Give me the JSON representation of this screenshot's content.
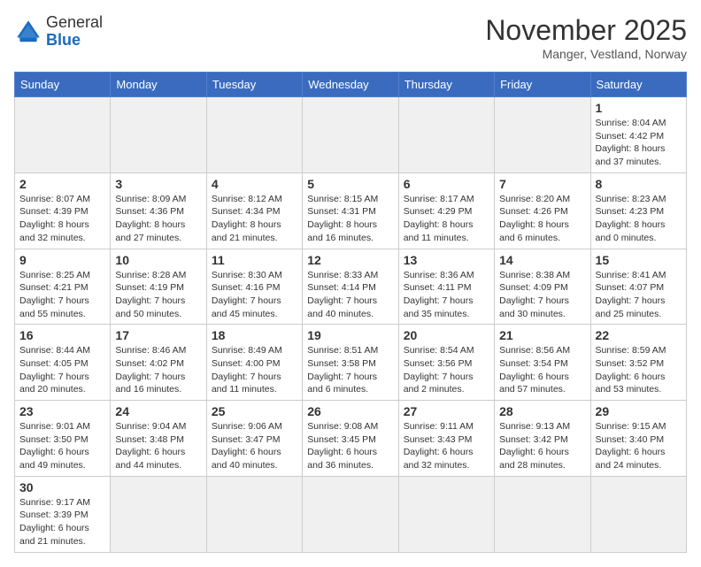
{
  "header": {
    "logo_general": "General",
    "logo_blue": "Blue",
    "month_title": "November 2025",
    "location": "Manger, Vestland, Norway"
  },
  "weekdays": [
    "Sunday",
    "Monday",
    "Tuesday",
    "Wednesday",
    "Thursday",
    "Friday",
    "Saturday"
  ],
  "weeks": [
    [
      {
        "day": null,
        "info": null
      },
      {
        "day": null,
        "info": null
      },
      {
        "day": null,
        "info": null
      },
      {
        "day": null,
        "info": null
      },
      {
        "day": null,
        "info": null
      },
      {
        "day": null,
        "info": null
      },
      {
        "day": "1",
        "info": "Sunrise: 8:04 AM\nSunset: 4:42 PM\nDaylight: 8 hours\nand 37 minutes."
      }
    ],
    [
      {
        "day": "2",
        "info": "Sunrise: 8:07 AM\nSunset: 4:39 PM\nDaylight: 8 hours\nand 32 minutes."
      },
      {
        "day": "3",
        "info": "Sunrise: 8:09 AM\nSunset: 4:36 PM\nDaylight: 8 hours\nand 27 minutes."
      },
      {
        "day": "4",
        "info": "Sunrise: 8:12 AM\nSunset: 4:34 PM\nDaylight: 8 hours\nand 21 minutes."
      },
      {
        "day": "5",
        "info": "Sunrise: 8:15 AM\nSunset: 4:31 PM\nDaylight: 8 hours\nand 16 minutes."
      },
      {
        "day": "6",
        "info": "Sunrise: 8:17 AM\nSunset: 4:29 PM\nDaylight: 8 hours\nand 11 minutes."
      },
      {
        "day": "7",
        "info": "Sunrise: 8:20 AM\nSunset: 4:26 PM\nDaylight: 8 hours\nand 6 minutes."
      },
      {
        "day": "8",
        "info": "Sunrise: 8:23 AM\nSunset: 4:23 PM\nDaylight: 8 hours\nand 0 minutes."
      }
    ],
    [
      {
        "day": "9",
        "info": "Sunrise: 8:25 AM\nSunset: 4:21 PM\nDaylight: 7 hours\nand 55 minutes."
      },
      {
        "day": "10",
        "info": "Sunrise: 8:28 AM\nSunset: 4:19 PM\nDaylight: 7 hours\nand 50 minutes."
      },
      {
        "day": "11",
        "info": "Sunrise: 8:30 AM\nSunset: 4:16 PM\nDaylight: 7 hours\nand 45 minutes."
      },
      {
        "day": "12",
        "info": "Sunrise: 8:33 AM\nSunset: 4:14 PM\nDaylight: 7 hours\nand 40 minutes."
      },
      {
        "day": "13",
        "info": "Sunrise: 8:36 AM\nSunset: 4:11 PM\nDaylight: 7 hours\nand 35 minutes."
      },
      {
        "day": "14",
        "info": "Sunrise: 8:38 AM\nSunset: 4:09 PM\nDaylight: 7 hours\nand 30 minutes."
      },
      {
        "day": "15",
        "info": "Sunrise: 8:41 AM\nSunset: 4:07 PM\nDaylight: 7 hours\nand 25 minutes."
      }
    ],
    [
      {
        "day": "16",
        "info": "Sunrise: 8:44 AM\nSunset: 4:05 PM\nDaylight: 7 hours\nand 20 minutes."
      },
      {
        "day": "17",
        "info": "Sunrise: 8:46 AM\nSunset: 4:02 PM\nDaylight: 7 hours\nand 16 minutes."
      },
      {
        "day": "18",
        "info": "Sunrise: 8:49 AM\nSunset: 4:00 PM\nDaylight: 7 hours\nand 11 minutes."
      },
      {
        "day": "19",
        "info": "Sunrise: 8:51 AM\nSunset: 3:58 PM\nDaylight: 7 hours\nand 6 minutes."
      },
      {
        "day": "20",
        "info": "Sunrise: 8:54 AM\nSunset: 3:56 PM\nDaylight: 7 hours\nand 2 minutes."
      },
      {
        "day": "21",
        "info": "Sunrise: 8:56 AM\nSunset: 3:54 PM\nDaylight: 6 hours\nand 57 minutes."
      },
      {
        "day": "22",
        "info": "Sunrise: 8:59 AM\nSunset: 3:52 PM\nDaylight: 6 hours\nand 53 minutes."
      }
    ],
    [
      {
        "day": "23",
        "info": "Sunrise: 9:01 AM\nSunset: 3:50 PM\nDaylight: 6 hours\nand 49 minutes."
      },
      {
        "day": "24",
        "info": "Sunrise: 9:04 AM\nSunset: 3:48 PM\nDaylight: 6 hours\nand 44 minutes."
      },
      {
        "day": "25",
        "info": "Sunrise: 9:06 AM\nSunset: 3:47 PM\nDaylight: 6 hours\nand 40 minutes."
      },
      {
        "day": "26",
        "info": "Sunrise: 9:08 AM\nSunset: 3:45 PM\nDaylight: 6 hours\nand 36 minutes."
      },
      {
        "day": "27",
        "info": "Sunrise: 9:11 AM\nSunset: 3:43 PM\nDaylight: 6 hours\nand 32 minutes."
      },
      {
        "day": "28",
        "info": "Sunrise: 9:13 AM\nSunset: 3:42 PM\nDaylight: 6 hours\nand 28 minutes."
      },
      {
        "day": "29",
        "info": "Sunrise: 9:15 AM\nSunset: 3:40 PM\nDaylight: 6 hours\nand 24 minutes."
      }
    ],
    [
      {
        "day": "30",
        "info": "Sunrise: 9:17 AM\nSunset: 3:39 PM\nDaylight: 6 hours\nand 21 minutes."
      },
      {
        "day": null,
        "info": null
      },
      {
        "day": null,
        "info": null
      },
      {
        "day": null,
        "info": null
      },
      {
        "day": null,
        "info": null
      },
      {
        "day": null,
        "info": null
      },
      {
        "day": null,
        "info": null
      }
    ]
  ]
}
